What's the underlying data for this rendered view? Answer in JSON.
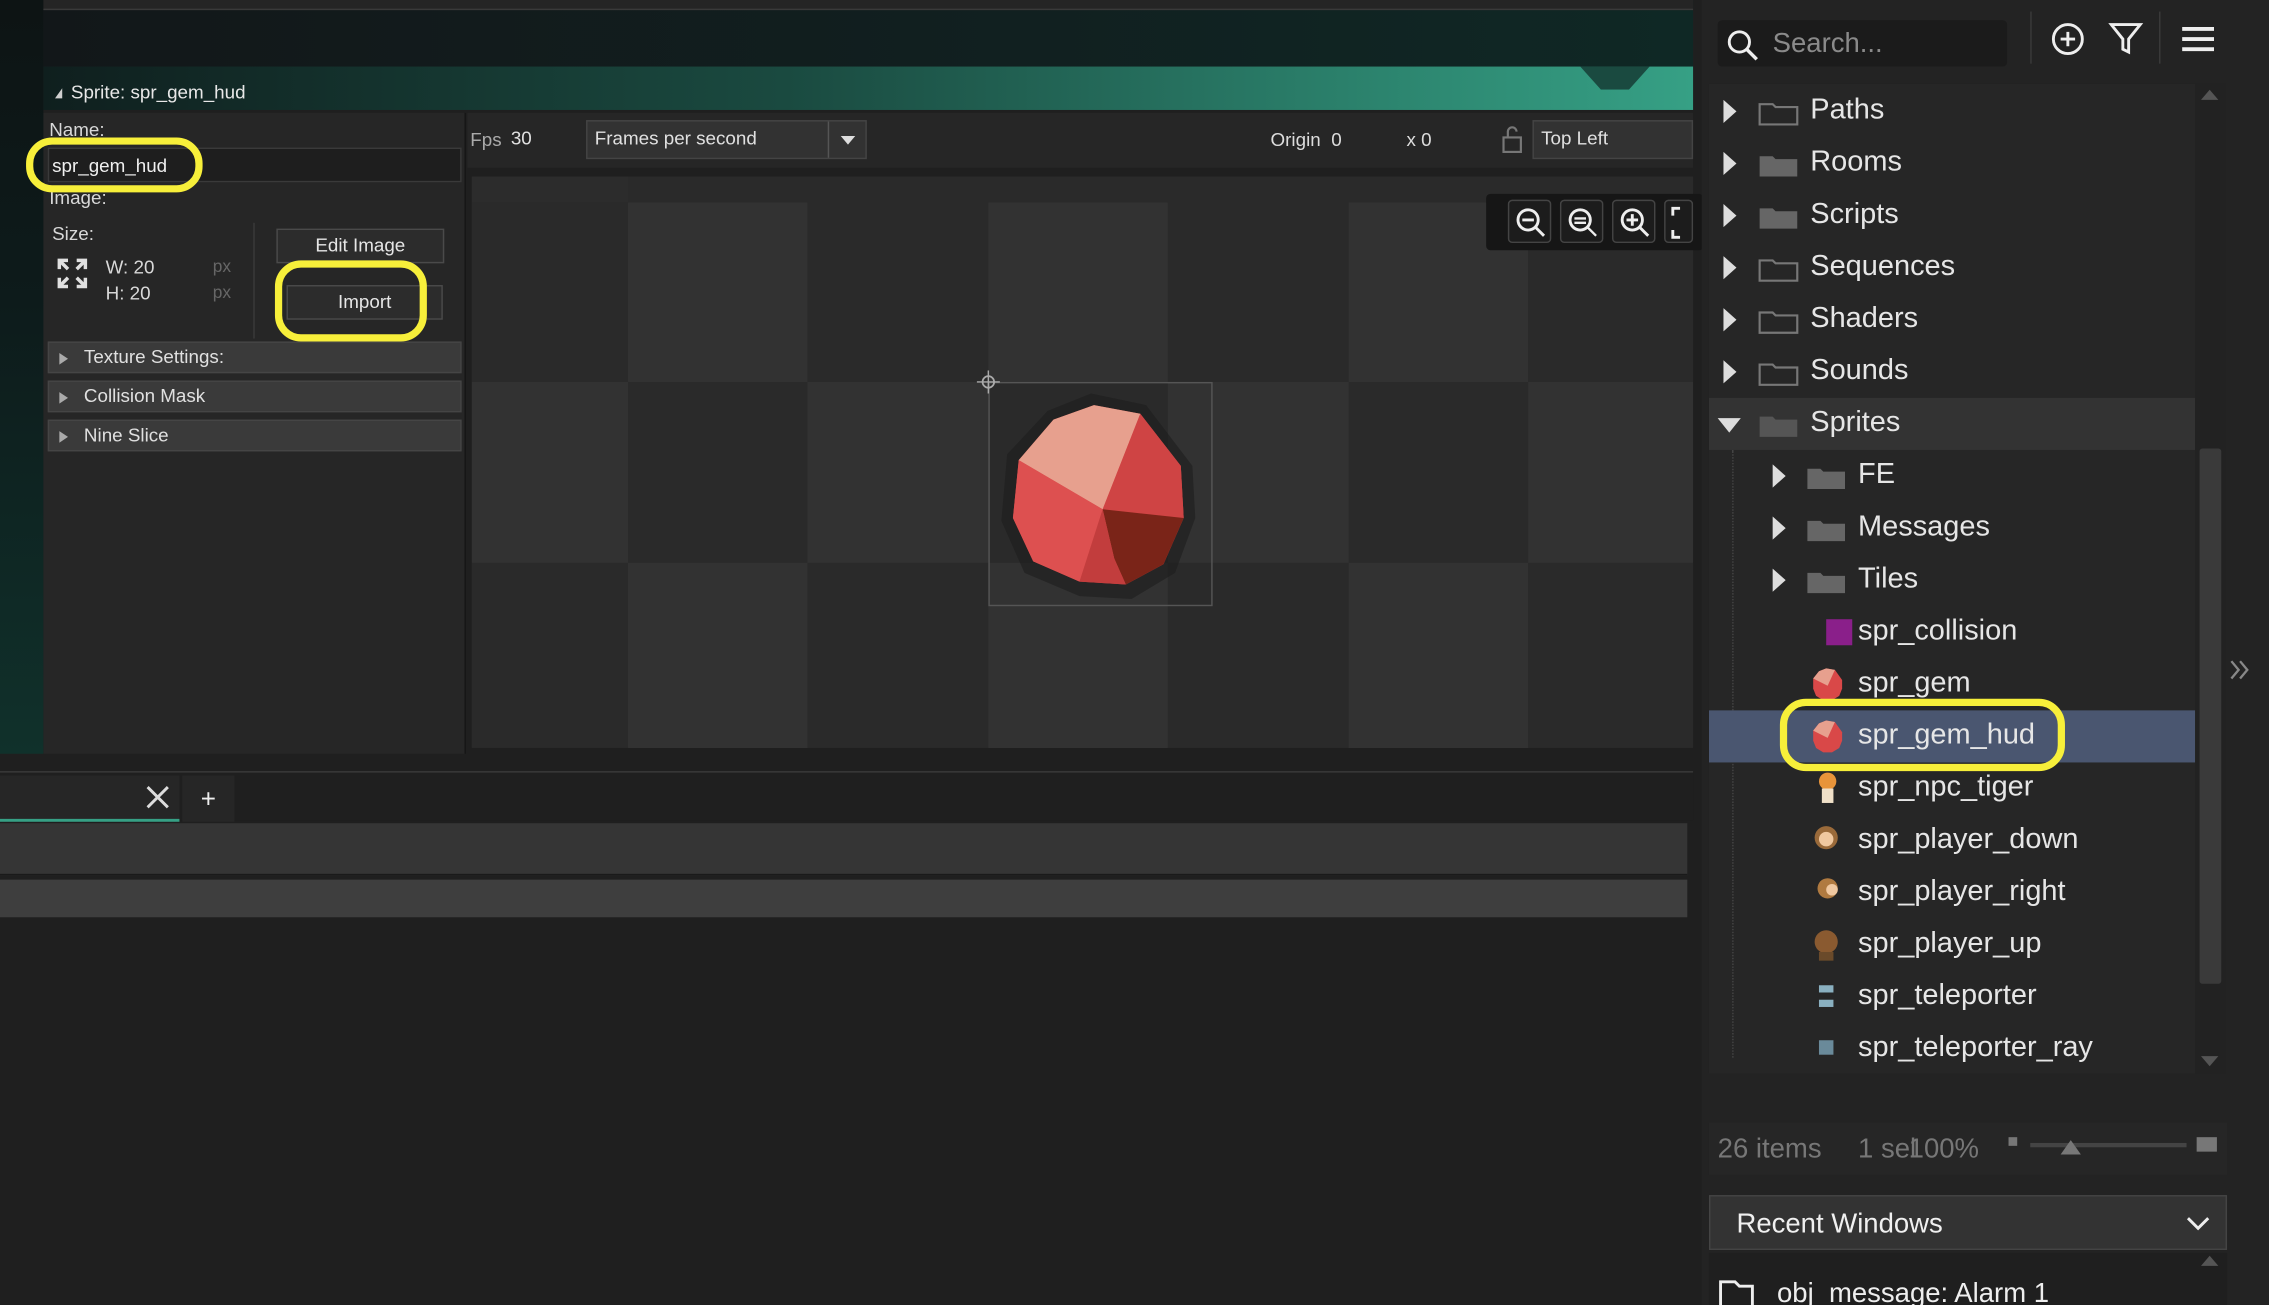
{
  "sprite_editor": {
    "window_title": "Sprite: spr_gem_hud",
    "name_label": "Name:",
    "name_value": "spr_gem_hud",
    "image_label": "Image:",
    "size_label": "Size:",
    "width": "W: 20",
    "height": "H: 20",
    "px_unit": "px",
    "edit_image_label": "Edit Image",
    "import_label": "Import",
    "sections": [
      "Texture Settings:",
      "Collision Mask",
      "Nine Slice"
    ]
  },
  "canvas_toolbar": {
    "fps_label": "Fps",
    "fps_value": "30",
    "fps_mode": "Frames per second",
    "origin_label": "Origin",
    "origin_x": "0",
    "origin_y": "x 0",
    "origin_preset": "Top Left"
  },
  "bottom_tabs": {
    "add_label": "+"
  },
  "asset_browser": {
    "search_placeholder": "Search...",
    "tree": [
      {
        "label": "Paths",
        "type": "folder"
      },
      {
        "label": "Rooms",
        "type": "folder"
      },
      {
        "label": "Scripts",
        "type": "folder"
      },
      {
        "label": "Sequences",
        "type": "folder"
      },
      {
        "label": "Shaders",
        "type": "folder"
      },
      {
        "label": "Sounds",
        "type": "folder"
      },
      {
        "label": "Sprites",
        "type": "folder",
        "expanded": true
      },
      {
        "label": "FE",
        "type": "folder"
      },
      {
        "label": "Messages",
        "type": "folder"
      },
      {
        "label": "Tiles",
        "type": "folder"
      },
      {
        "label": "spr_collision",
        "type": "sprite"
      },
      {
        "label": "spr_gem",
        "type": "sprite"
      },
      {
        "label": "spr_gem_hud",
        "type": "sprite",
        "selected": true
      },
      {
        "label": "spr_npc_tiger",
        "type": "sprite"
      },
      {
        "label": "spr_player_down",
        "type": "sprite"
      },
      {
        "label": "spr_player_right",
        "type": "sprite"
      },
      {
        "label": "spr_player_up",
        "type": "sprite"
      },
      {
        "label": "spr_teleporter",
        "type": "sprite"
      },
      {
        "label": "spr_teleporter_ray",
        "type": "sprite"
      }
    ],
    "item_count": "26 items",
    "selection": "1 sel",
    "zoom": "100%",
    "recent_windows_label": "Recent Windows",
    "recent_item": "obj_message: Alarm 1"
  },
  "colors": {
    "highlight": "#f7ef3a",
    "accent": "#36a085",
    "selection": "#4a5670",
    "gem_red": "#d94848"
  }
}
